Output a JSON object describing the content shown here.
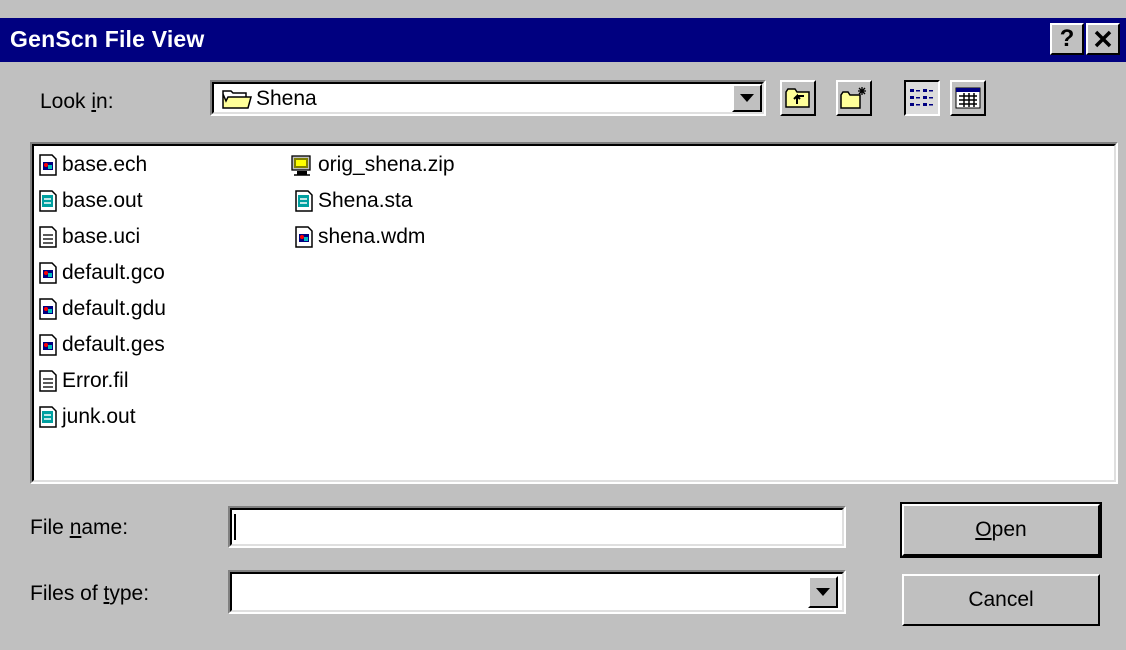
{
  "window": {
    "title": "GenScn File View"
  },
  "titlebar_buttons": {
    "help": "?",
    "close": "×"
  },
  "look_in": {
    "label_pre": "Look ",
    "label_u": "i",
    "label_post": "n:",
    "value": "Shena"
  },
  "files": [
    {
      "name": "base.ech",
      "icon": "data-file-icon"
    },
    {
      "name": "base.out",
      "icon": "text-file-icon"
    },
    {
      "name": "base.uci",
      "icon": "document-icon"
    },
    {
      "name": "default.gco",
      "icon": "data-file-icon"
    },
    {
      "name": "default.gdu",
      "icon": "data-file-icon"
    },
    {
      "name": "default.ges",
      "icon": "data-file-icon"
    },
    {
      "name": "Error.fil",
      "icon": "document-icon"
    },
    {
      "name": "junk.out",
      "icon": "text-file-icon"
    },
    {
      "name": "orig_shena.zip",
      "icon": "zip-archive-icon"
    },
    {
      "name": "Shena.sta",
      "icon": "text-file-icon"
    },
    {
      "name": "shena.wdm",
      "icon": "data-file-icon"
    }
  ],
  "file_name": {
    "label_pre": "File ",
    "label_u": "n",
    "label_post": "ame:",
    "value": ""
  },
  "files_of_type": {
    "label_pre": "Files of ",
    "label_u": "t",
    "label_post": "ype:",
    "value": ""
  },
  "buttons": {
    "open_u": "O",
    "open_rest": "pen",
    "cancel": "Cancel"
  },
  "colors": {
    "titlebar": "#000080",
    "face": "#c0c0c0",
    "window": "#ffffff"
  }
}
